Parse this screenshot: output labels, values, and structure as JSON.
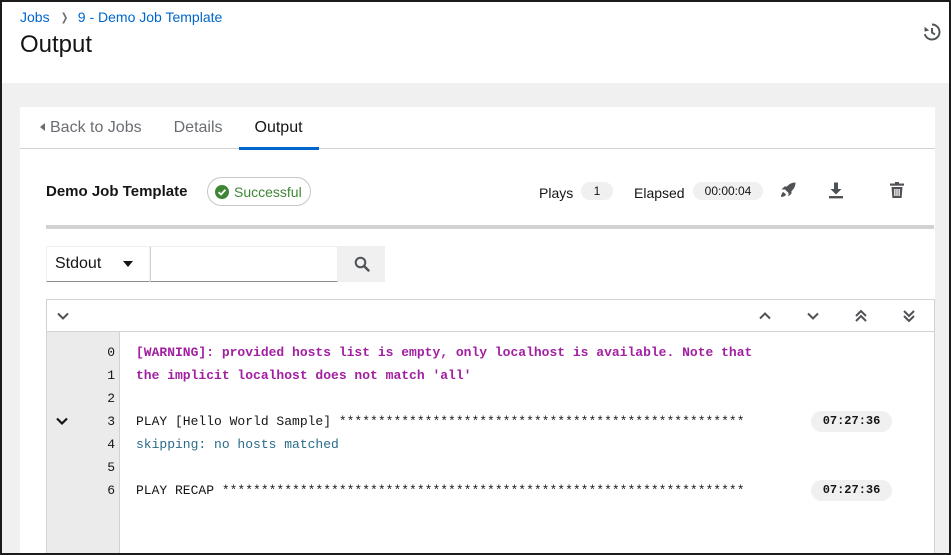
{
  "breadcrumb": {
    "jobs_label": "Jobs",
    "current_label": "9 - Demo Job Template"
  },
  "page": {
    "title": "Output"
  },
  "tabs": [
    {
      "label": "Back to Jobs"
    },
    {
      "label": "Details"
    },
    {
      "label": "Output"
    }
  ],
  "summary": {
    "job_name": "Demo Job Template",
    "status": "Successful",
    "plays_label": "Plays",
    "plays_count": "1",
    "elapsed_label": "Elapsed",
    "elapsed_value": "00:00:04"
  },
  "icons": {
    "history": "history-icon",
    "relaunch": "rocket-icon",
    "download": "download-icon",
    "delete": "trash-icon"
  },
  "filter": {
    "selected": "Stdout",
    "search_placeholder": ""
  },
  "output": {
    "lines": [
      {
        "num": "0",
        "text": "[WARNING]: provided hosts list is empty, only localhost is available. Note that",
        "kind": "warn"
      },
      {
        "num": "1",
        "text": "the implicit localhost does not match 'all'",
        "kind": "warn"
      },
      {
        "num": "2",
        "text": "",
        "kind": "plain"
      },
      {
        "num": "3",
        "text": "PLAY [Hello World Sample] ****************************************************",
        "kind": "plain",
        "time": "07:27:36"
      },
      {
        "num": "4",
        "text": "skipping: no hosts matched",
        "kind": "skip"
      },
      {
        "num": "5",
        "text": "",
        "kind": "plain"
      },
      {
        "num": "6",
        "text": "PLAY RECAP *******************************************************************",
        "kind": "plain",
        "time": "07:27:36"
      }
    ]
  },
  "colors": {
    "link": "#0066cc",
    "success": "#3e8635",
    "warning_text": "#a11fa1",
    "skip_text": "#2b6b8a"
  }
}
